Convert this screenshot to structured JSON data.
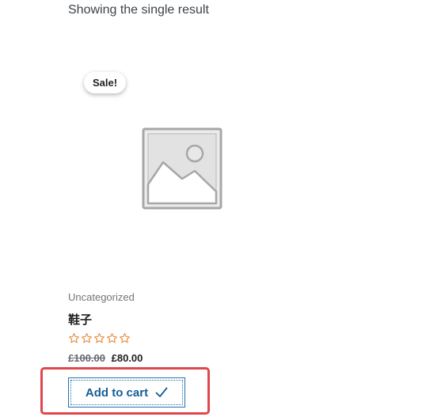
{
  "shop": {
    "result_count": "Showing the single result"
  },
  "product": {
    "sale_badge": "Sale!",
    "image_icon": "image-placeholder-icon",
    "category": "Uncategorized",
    "title": "鞋子",
    "rating_stars": 0,
    "rating_max": 5,
    "star_icon": "star-outline-icon",
    "regular_price": "£100.00",
    "sale_price": "£80.00",
    "add_to_cart_label": "Add to cart",
    "added_icon": "checkmark-icon"
  },
  "colors": {
    "accent": "#2271b1",
    "star": "#e68a3c",
    "highlight": "#e0474c"
  }
}
